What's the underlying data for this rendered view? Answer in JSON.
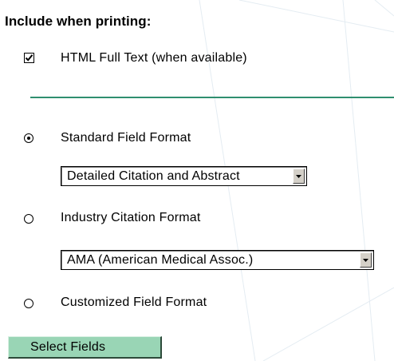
{
  "print_options": {
    "heading": "Include when printing:",
    "html_full_text": {
      "label": "HTML Full Text (when available)",
      "checked": true
    },
    "standard_format": {
      "label": "Standard Field Format",
      "selected": true,
      "dropdown_value": "Detailed Citation and Abstract"
    },
    "industry_format": {
      "label": "Industry Citation Format",
      "selected": false,
      "dropdown_value": "AMA (American Medical Assoc.)"
    },
    "custom_format": {
      "label": "Customized Field Format",
      "selected": false
    },
    "select_fields_button": "Select Fields"
  },
  "colors": {
    "divider": "#2f8f6f",
    "button_bg": "#99d5b5",
    "background_lines": "#e4ecf2"
  }
}
